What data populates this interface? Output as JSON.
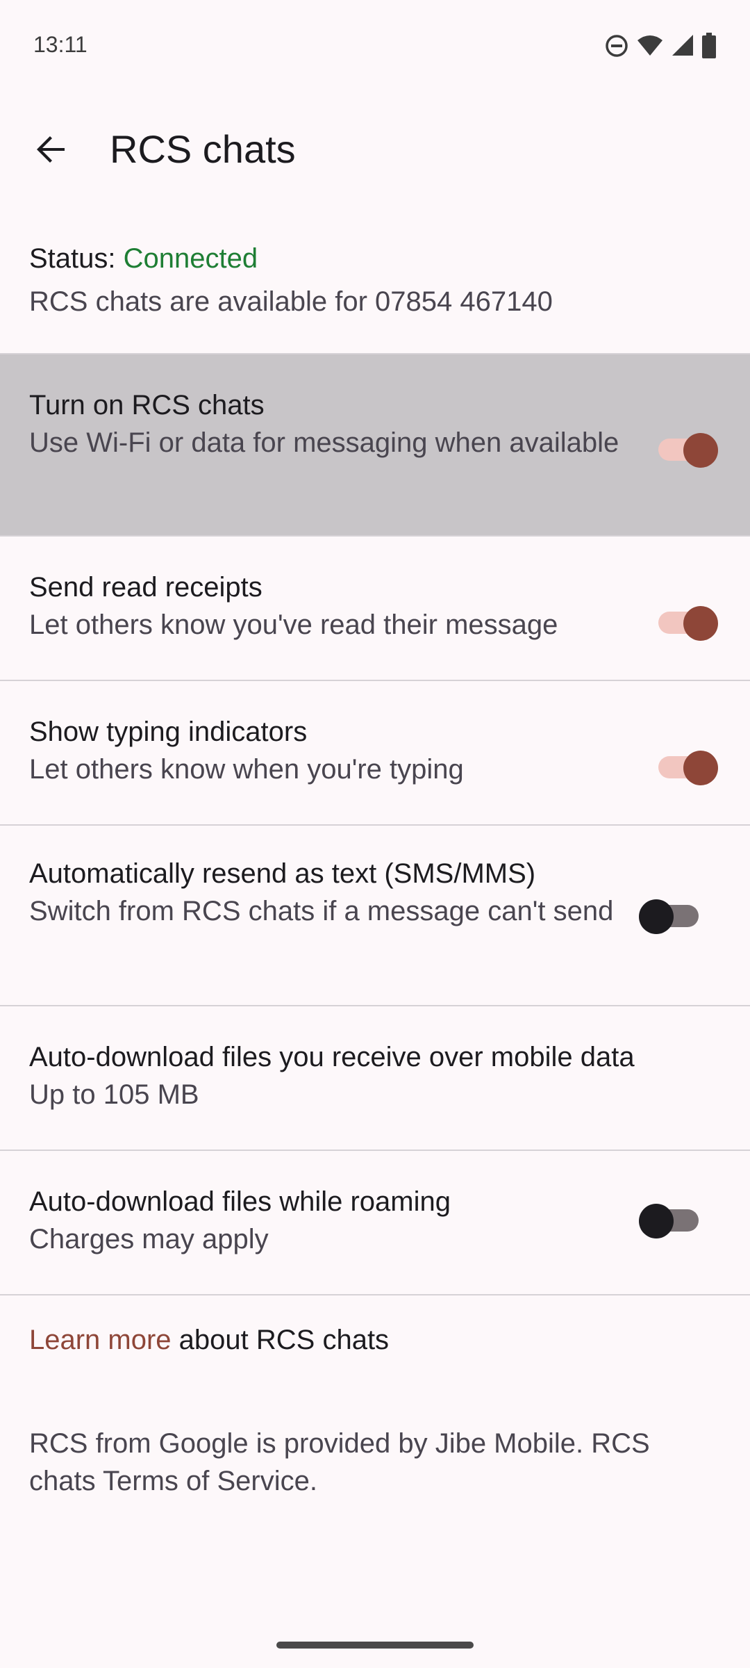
{
  "status_bar": {
    "time": "13:11",
    "icons": [
      "do-not-disturb-icon",
      "wifi-icon",
      "cellular-signal-icon",
      "battery-icon"
    ]
  },
  "top_bar": {
    "title": "RCS chats",
    "back_icon": "arrow-back-icon"
  },
  "status": {
    "label": "Status: ",
    "value": "Connected",
    "value_color": "#1e7e34",
    "availability": "RCS chats are available for 07854 467140"
  },
  "settings": [
    {
      "title": "Turn on RCS chats",
      "subtitle": "Use Wi-Fi or data for messaging when available",
      "toggle": true,
      "highlighted": true
    },
    {
      "title": "Send read receipts",
      "subtitle": "Let others know you've read their message",
      "toggle": true
    },
    {
      "title": "Show typing indicators",
      "subtitle": "Let others know when you're typing",
      "toggle": true
    },
    {
      "title": "Automatically resend as text (SMS/MMS)",
      "subtitle": "Switch from RCS chats if a message can't send",
      "toggle": false
    },
    {
      "title": "Auto-download files you receive over mobile data",
      "subtitle": "Up to 105 MB"
    },
    {
      "title": "Auto-download files while roaming",
      "subtitle": "Charges may apply",
      "toggle": false
    }
  ],
  "learn_more": {
    "link": "Learn more",
    "text": " about RCS chats"
  },
  "footer": "RCS from Google is provided by Jibe Mobile. RCS chats Terms of Service.",
  "colors": {
    "accent": "#8e4638",
    "switch_on_track": "#f2c6c0",
    "background": "#fdf8fa"
  }
}
